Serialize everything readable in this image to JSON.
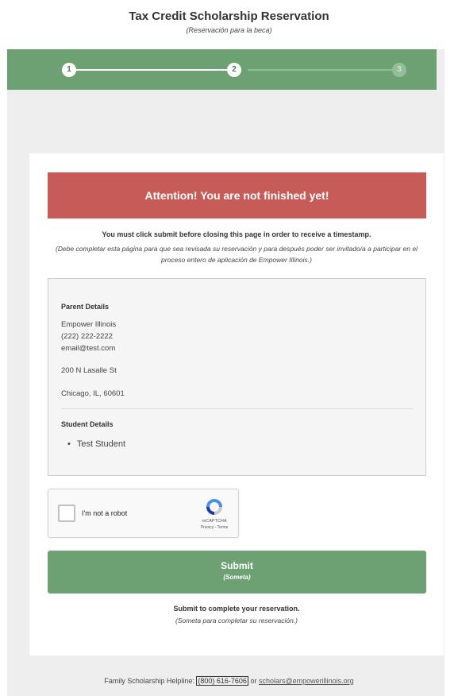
{
  "header": {
    "title": "Tax Credit Scholarship Reservation",
    "subtitle": "(Reservación para la beca)"
  },
  "stepper": {
    "steps": [
      "1",
      "2",
      "3"
    ],
    "current_step": 2
  },
  "alert": {
    "text": "Attention! You are not finished yet!"
  },
  "notice": {
    "main": "You must click submit before closing this page in order to receive a timestamp.",
    "sub": "(Debe completar esta página para que sea revisada su reservación y para después poder ser invitado/a a participar en el proceso entero de aplicación de Empower Illinois.)"
  },
  "parent_details": {
    "heading": "Parent Details",
    "name": "Empower Illinois",
    "phone": "(222) 222-2222",
    "email": "email@test.com",
    "address_line1": "200 N Lasalle St",
    "address_line2": "Chicago, IL, 60601"
  },
  "student_details": {
    "heading": "Student Details",
    "students": [
      "Test Student"
    ]
  },
  "captcha": {
    "label": "I'm not a robot",
    "brand": "reCAPTCHA",
    "terms": "Privacy - Terms"
  },
  "submit": {
    "label": "Submit",
    "sub_label": "(Someta)"
  },
  "after_submit": {
    "main": "Submit to complete your reservation.",
    "sub": "(Someta para completar su reservación.)"
  },
  "footer": {
    "prefix": "Family Scholarship Helpline:",
    "phone": "(800) 616-7606",
    "joiner": "or",
    "email": "scholars@empowerillinois.org"
  },
  "colors": {
    "green": "#6da174",
    "alert_red": "#c75b58"
  }
}
